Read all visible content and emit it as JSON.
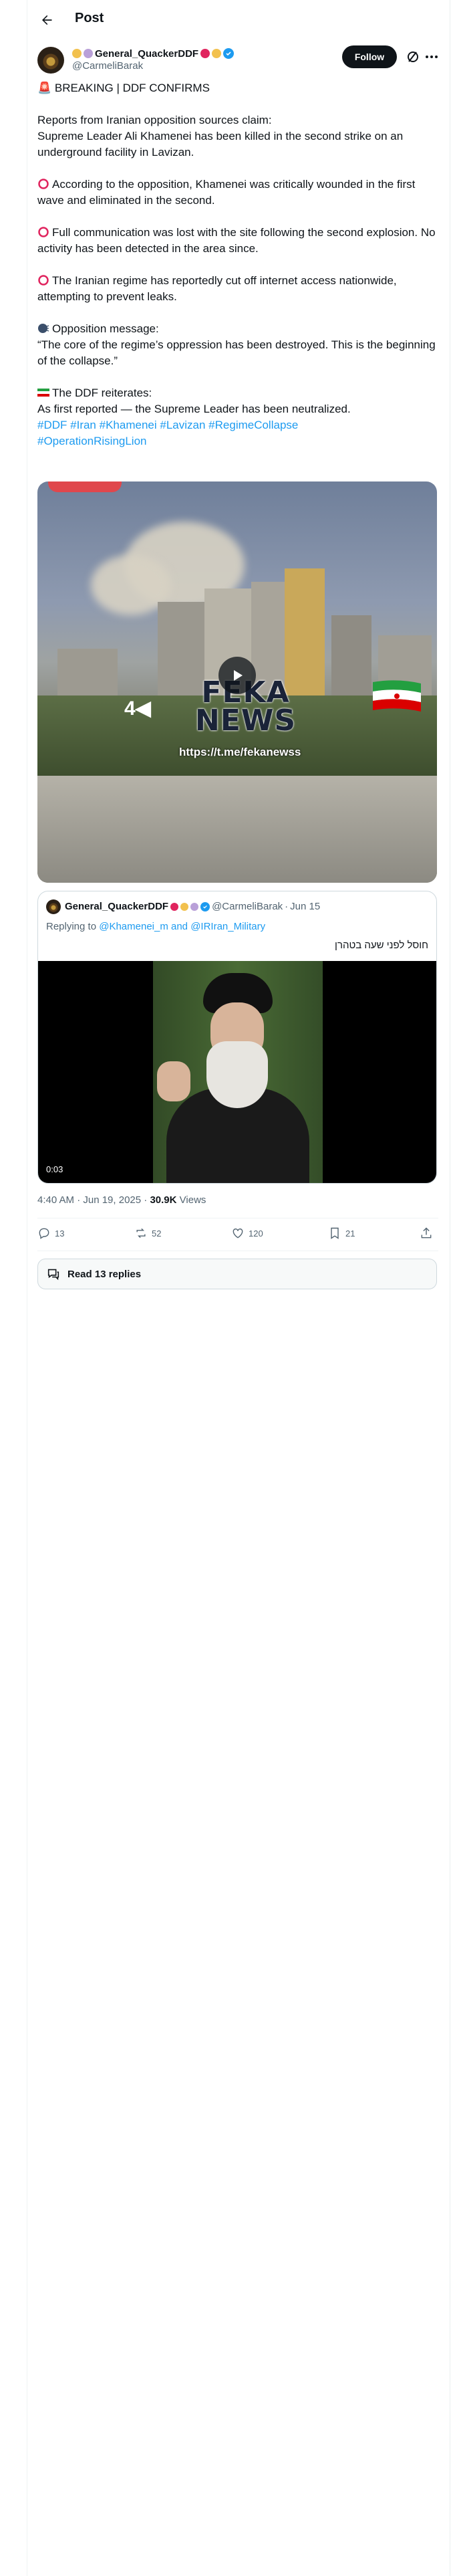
{
  "header": {
    "title": "Post"
  },
  "author": {
    "name": "General_QuackerDDF",
    "handle": "@CarmeliBarak",
    "follow_label": "Follow"
  },
  "post": {
    "headline": "🚨 BREAKING | DDF CONFIRMS",
    "p1_line1": "Reports from Iranian opposition sources claim:",
    "p1_line2": "Supreme Leader Ali Khamenei has been killed in the second strike on an underground facility in Lavizan.",
    "p2": "According to the opposition, Khamenei was critically wounded in the first wave and eliminated in the second.",
    "p3": "Full communication was lost with the site following the second explosion. No activity has been detected in the area since.",
    "p4": "The Iranian regime has reportedly cut off internet access nationwide, attempting to prevent leaks.",
    "p5_title": "Opposition message:",
    "p5_quote": "“The core of the regime’s oppression has been destroyed. This is the beginning of the collapse.”",
    "p6_title": "The DDF reiterates:",
    "p6_text": "As first reported — the Supreme Leader has been neutralized.",
    "hashtags": [
      "#DDF",
      "#Iran",
      "#Khamenei",
      "#Lavizan",
      "#RegimeCollapse",
      "#OperationRisingLion"
    ]
  },
  "video": {
    "watermark_title": "FEKA",
    "watermark_title2": "NEWS",
    "watermark_url": "https://t.me/fekanewss",
    "watermark_mark": "4◀"
  },
  "quoted": {
    "name": "General_QuackerDDF",
    "handle": "@CarmeliBarak",
    "date": "Jun 15",
    "replying_prefix": "Replying to",
    "replying_to": "@Khamenei_m and @IRIran_Military",
    "text": "חוסל לפני שעה בטהרן",
    "duration": "0:03"
  },
  "meta": {
    "time": "4:40 AM · Jun 19, 2025 ·",
    "views_count": "30.9K",
    "views_label": "Views"
  },
  "actions": {
    "replies": "13",
    "reposts": "52",
    "likes": "120",
    "bookmarks": "21"
  },
  "read_replies": "Read 13 replies",
  "colors": {
    "accent": "#1d9bf0",
    "text": "#0f1419",
    "secondary": "#536471"
  },
  "icons": [
    "back-arrow-icon",
    "verified-icon",
    "grok-icon",
    "more-icon",
    "play-icon",
    "reply-icon",
    "repost-icon",
    "like-icon",
    "bookmark-icon",
    "share-icon",
    "chat-bubbles-icon"
  ]
}
